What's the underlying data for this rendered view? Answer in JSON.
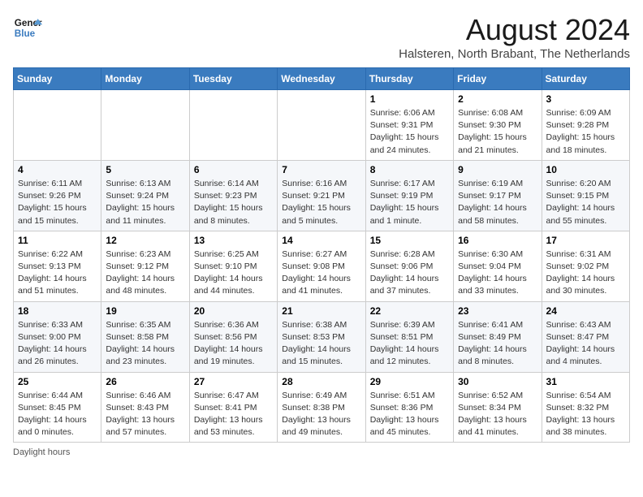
{
  "logo": {
    "line1": "General",
    "line2": "Blue"
  },
  "title": "August 2024",
  "subtitle": "Halsteren, North Brabant, The Netherlands",
  "days_of_week": [
    "Sunday",
    "Monday",
    "Tuesday",
    "Wednesday",
    "Thursday",
    "Friday",
    "Saturday"
  ],
  "footer": "Daylight hours",
  "weeks": [
    [
      {
        "day": "",
        "info": ""
      },
      {
        "day": "",
        "info": ""
      },
      {
        "day": "",
        "info": ""
      },
      {
        "day": "",
        "info": ""
      },
      {
        "day": "1",
        "info": "Sunrise: 6:06 AM\nSunset: 9:31 PM\nDaylight: 15 hours and 24 minutes."
      },
      {
        "day": "2",
        "info": "Sunrise: 6:08 AM\nSunset: 9:30 PM\nDaylight: 15 hours and 21 minutes."
      },
      {
        "day": "3",
        "info": "Sunrise: 6:09 AM\nSunset: 9:28 PM\nDaylight: 15 hours and 18 minutes."
      }
    ],
    [
      {
        "day": "4",
        "info": "Sunrise: 6:11 AM\nSunset: 9:26 PM\nDaylight: 15 hours and 15 minutes."
      },
      {
        "day": "5",
        "info": "Sunrise: 6:13 AM\nSunset: 9:24 PM\nDaylight: 15 hours and 11 minutes."
      },
      {
        "day": "6",
        "info": "Sunrise: 6:14 AM\nSunset: 9:23 PM\nDaylight: 15 hours and 8 minutes."
      },
      {
        "day": "7",
        "info": "Sunrise: 6:16 AM\nSunset: 9:21 PM\nDaylight: 15 hours and 5 minutes."
      },
      {
        "day": "8",
        "info": "Sunrise: 6:17 AM\nSunset: 9:19 PM\nDaylight: 15 hours and 1 minute."
      },
      {
        "day": "9",
        "info": "Sunrise: 6:19 AM\nSunset: 9:17 PM\nDaylight: 14 hours and 58 minutes."
      },
      {
        "day": "10",
        "info": "Sunrise: 6:20 AM\nSunset: 9:15 PM\nDaylight: 14 hours and 55 minutes."
      }
    ],
    [
      {
        "day": "11",
        "info": "Sunrise: 6:22 AM\nSunset: 9:13 PM\nDaylight: 14 hours and 51 minutes."
      },
      {
        "day": "12",
        "info": "Sunrise: 6:23 AM\nSunset: 9:12 PM\nDaylight: 14 hours and 48 minutes."
      },
      {
        "day": "13",
        "info": "Sunrise: 6:25 AM\nSunset: 9:10 PM\nDaylight: 14 hours and 44 minutes."
      },
      {
        "day": "14",
        "info": "Sunrise: 6:27 AM\nSunset: 9:08 PM\nDaylight: 14 hours and 41 minutes."
      },
      {
        "day": "15",
        "info": "Sunrise: 6:28 AM\nSunset: 9:06 PM\nDaylight: 14 hours and 37 minutes."
      },
      {
        "day": "16",
        "info": "Sunrise: 6:30 AM\nSunset: 9:04 PM\nDaylight: 14 hours and 33 minutes."
      },
      {
        "day": "17",
        "info": "Sunrise: 6:31 AM\nSunset: 9:02 PM\nDaylight: 14 hours and 30 minutes."
      }
    ],
    [
      {
        "day": "18",
        "info": "Sunrise: 6:33 AM\nSunset: 9:00 PM\nDaylight: 14 hours and 26 minutes."
      },
      {
        "day": "19",
        "info": "Sunrise: 6:35 AM\nSunset: 8:58 PM\nDaylight: 14 hours and 23 minutes."
      },
      {
        "day": "20",
        "info": "Sunrise: 6:36 AM\nSunset: 8:56 PM\nDaylight: 14 hours and 19 minutes."
      },
      {
        "day": "21",
        "info": "Sunrise: 6:38 AM\nSunset: 8:53 PM\nDaylight: 14 hours and 15 minutes."
      },
      {
        "day": "22",
        "info": "Sunrise: 6:39 AM\nSunset: 8:51 PM\nDaylight: 14 hours and 12 minutes."
      },
      {
        "day": "23",
        "info": "Sunrise: 6:41 AM\nSunset: 8:49 PM\nDaylight: 14 hours and 8 minutes."
      },
      {
        "day": "24",
        "info": "Sunrise: 6:43 AM\nSunset: 8:47 PM\nDaylight: 14 hours and 4 minutes."
      }
    ],
    [
      {
        "day": "25",
        "info": "Sunrise: 6:44 AM\nSunset: 8:45 PM\nDaylight: 14 hours and 0 minutes."
      },
      {
        "day": "26",
        "info": "Sunrise: 6:46 AM\nSunset: 8:43 PM\nDaylight: 13 hours and 57 minutes."
      },
      {
        "day": "27",
        "info": "Sunrise: 6:47 AM\nSunset: 8:41 PM\nDaylight: 13 hours and 53 minutes."
      },
      {
        "day": "28",
        "info": "Sunrise: 6:49 AM\nSunset: 8:38 PM\nDaylight: 13 hours and 49 minutes."
      },
      {
        "day": "29",
        "info": "Sunrise: 6:51 AM\nSunset: 8:36 PM\nDaylight: 13 hours and 45 minutes."
      },
      {
        "day": "30",
        "info": "Sunrise: 6:52 AM\nSunset: 8:34 PM\nDaylight: 13 hours and 41 minutes."
      },
      {
        "day": "31",
        "info": "Sunrise: 6:54 AM\nSunset: 8:32 PM\nDaylight: 13 hours and 38 minutes."
      }
    ]
  ]
}
